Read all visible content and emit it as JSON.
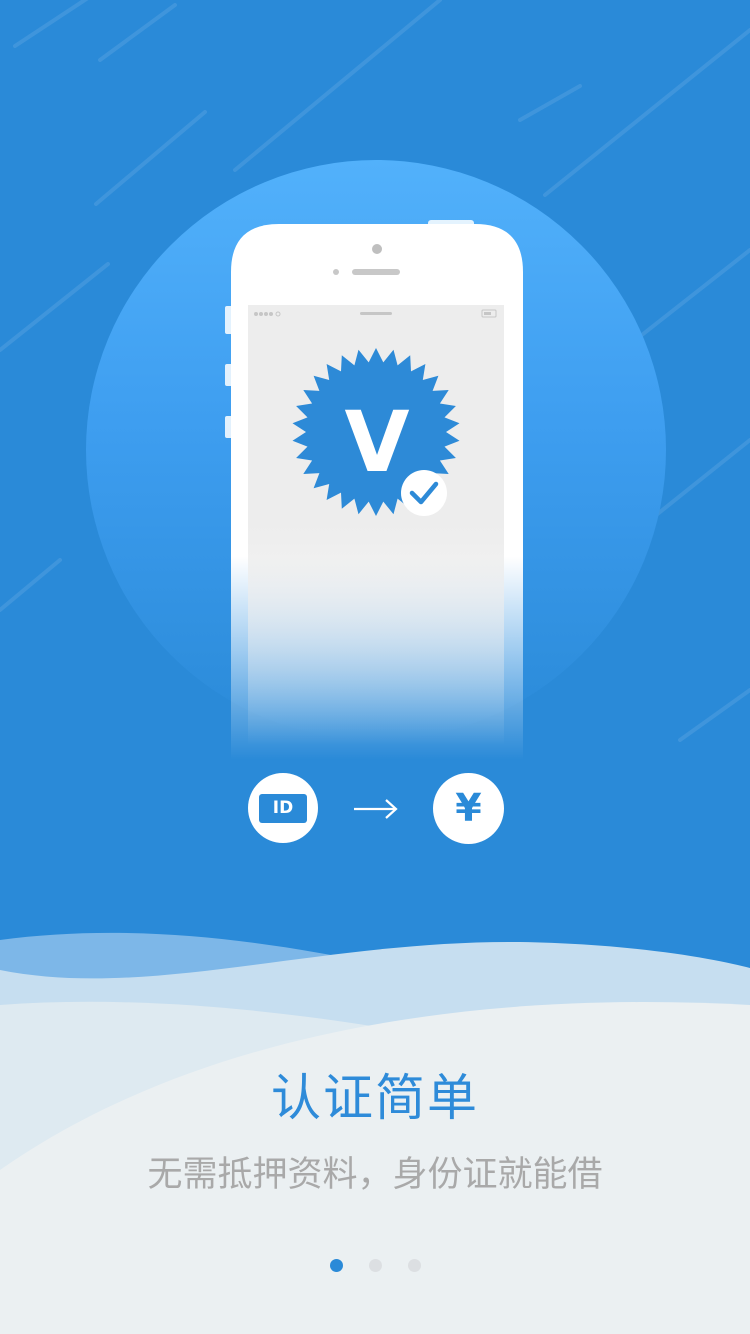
{
  "onboarding": {
    "title": "认证简单",
    "subtitle": "无需抵押资料，身份证就能借",
    "page_count": 3,
    "active_page_index": 0
  },
  "hero": {
    "badge_letter": "V",
    "badge_check_icon": "checkmark-icon"
  },
  "flow": {
    "id_icon_label": "ID",
    "arrow_icon": "right-arrow-icon",
    "money_symbol": "¥"
  },
  "colors": {
    "background": "#2a8ad8",
    "title": "#2e8bd9",
    "subtitle": "#a9a9a9",
    "dot_active": "#2a8ad8",
    "dot_inactive": "#dcdfe2"
  }
}
